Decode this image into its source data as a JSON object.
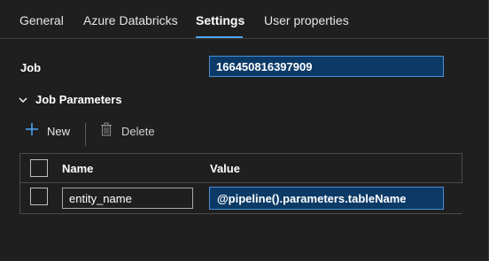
{
  "tabs": [
    {
      "label": "General"
    },
    {
      "label": "Azure Databricks"
    },
    {
      "label": "Settings",
      "active": true
    },
    {
      "label": "User properties"
    }
  ],
  "job": {
    "label": "Job",
    "value": "166450816397909"
  },
  "parameters": {
    "section_title": "Job Parameters",
    "toolbar": {
      "new_label": "New",
      "delete_label": "Delete"
    },
    "columns": {
      "name": "Name",
      "value": "Value"
    },
    "rows": [
      {
        "name": "entity_name",
        "value": "@pipeline().parameters.tableName"
      }
    ]
  },
  "colors": {
    "background": "#1f1f1f",
    "accent": "#4aa3f0",
    "highlight_field": "#0c3a66"
  },
  "icons": {
    "collapse": "chevron-down-icon",
    "new": "plus-icon",
    "delete": "trash-icon"
  }
}
